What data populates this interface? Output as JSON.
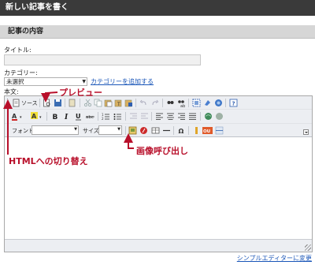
{
  "header": {
    "title": "新しい記事を書く"
  },
  "section": {
    "title": "記事の内容"
  },
  "form": {
    "title_label": "タイトル:",
    "title_value": "",
    "category_label": "カテゴリー:",
    "category_selected": "未選択",
    "add_category_link": "カテゴリーを追加する",
    "body_label": "本文:"
  },
  "editor": {
    "source_button": "ソース",
    "font_label": "フォント",
    "size_label": "サイズ"
  },
  "footer": {
    "simple_editor_link": "シンプルエディターに変更"
  },
  "annotations": {
    "preview": "プレビュー",
    "html_switch": "HTMLへの切り替え",
    "image_call": "画像呼び出し"
  },
  "colors": {
    "header_bg": "#3a3a3a",
    "annotation": "#b80f2a",
    "link": "#1a56b8",
    "toolbar_bg": "#eceef2"
  }
}
